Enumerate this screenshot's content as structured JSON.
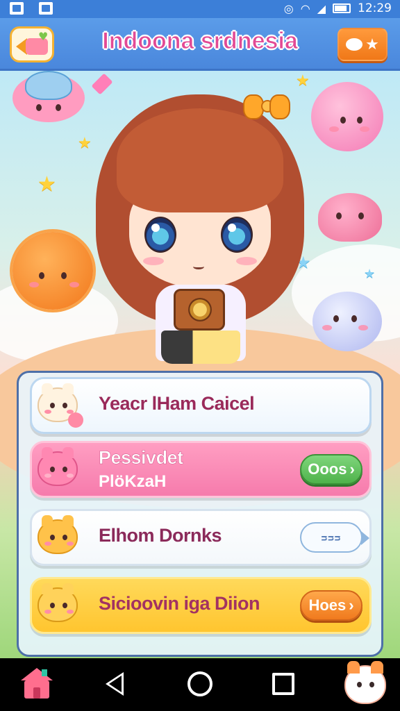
{
  "status_bar": {
    "time": "12:29",
    "wifi_icon": "wifi-icon",
    "signal_icon": "signal-icon",
    "battery_icon": "battery-icon"
  },
  "header": {
    "title": "Indoona srdnesia",
    "back_icon": "back-home-icon",
    "chat_icon": "chat-star-icon",
    "title_color": "#e24a95"
  },
  "menu": {
    "rows": [
      {
        "label": "Yeacr lHam Caicel",
        "icon": "bear-icon"
      },
      {
        "label": "Pessivdet",
        "sublabel": "PlöKzaH",
        "button": "Ooos",
        "icon": "pink-creature-icon",
        "button_color": "#4fb24b"
      },
      {
        "label": "Elhom Dornks",
        "button": "ᴝᴝᴝ",
        "icon": "orange-cat-icon"
      },
      {
        "label": "Sicioovin iga Diion",
        "button": "Hoes",
        "icon": "yellow-cat-icon",
        "button_color": "#f07a1e"
      }
    ]
  },
  "navbar": {
    "home_icon": "home-icon",
    "back_icon": "nav-back-icon",
    "circle_icon": "nav-home-circle-icon",
    "recents_icon": "nav-recents-icon",
    "mascot_icon": "mascot-icon"
  }
}
